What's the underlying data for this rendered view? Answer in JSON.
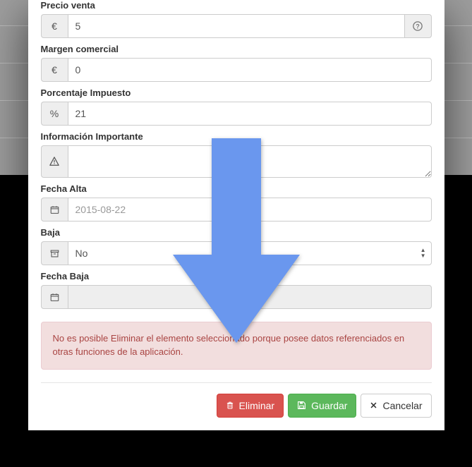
{
  "precio_venta": {
    "label": "Precio venta",
    "symbol": "€",
    "value": "5"
  },
  "margen_comercial": {
    "label": "Margen comercial",
    "symbol": "€",
    "value": "0"
  },
  "porcentaje_impuesto": {
    "label": "Porcentaje Impuesto",
    "symbol": "%",
    "value": "21"
  },
  "info_importante": {
    "label": "Información Importante",
    "value": ""
  },
  "fecha_alta": {
    "label": "Fecha Alta",
    "value": "2015-08-22"
  },
  "baja": {
    "label": "Baja",
    "selected": "No"
  },
  "fecha_baja": {
    "label": "Fecha Baja",
    "value": ""
  },
  "alert_text": "No es posible Eliminar el elemento seleccionado porque posee datos referenciados en otras funciones de la aplicación.",
  "buttons": {
    "eliminar": "Eliminar",
    "guardar": "Guardar",
    "cancelar": "Cancelar"
  }
}
